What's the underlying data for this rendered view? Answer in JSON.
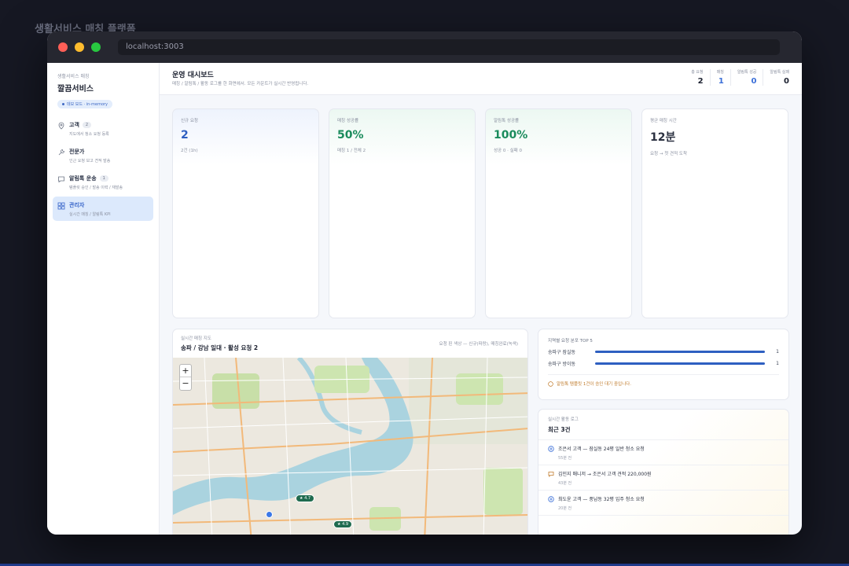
{
  "outer_title": "생활서비스 매칭 플랫폼",
  "browser": {
    "url": "localhost:3003"
  },
  "sidebar": {
    "brand_sub": "생활서비스 매칭",
    "brand": "깔끔서비스",
    "badge": "데모 모드 · in-memory",
    "items": [
      {
        "title": "고객",
        "count": "2",
        "desc": "지도에서 청소 요청 등록",
        "icon": "map-pin-icon"
      },
      {
        "title": "전문가",
        "desc": "인근 요청 보고 견적 발송",
        "icon": "wrench-icon"
      },
      {
        "title": "알림톡 운송",
        "count": "1",
        "desc": "템플릿 승인 / 발송 이력 / 재발송",
        "icon": "message-icon"
      },
      {
        "title": "관리자",
        "desc": "실시간 매칭 / 알림톡 KPI",
        "icon": "dashboard-icon"
      }
    ]
  },
  "header": {
    "title": "운영 대시보드",
    "subtitle": "매칭 / 알림톡 / 활동 로그를 한 화면에서. 모든 카운트가 실시간 반영됩니다.",
    "stats": [
      {
        "label": "총 요청",
        "value": "2",
        "color": "dark"
      },
      {
        "label": "매칭",
        "value": "1",
        "color": "blue"
      },
      {
        "label": "알림톡 성공",
        "value": "0",
        "color": "blue"
      },
      {
        "label": "알림톡 실패",
        "value": "0",
        "color": "dark"
      }
    ]
  },
  "kpis": [
    {
      "label": "신규 요청",
      "value": "2",
      "desc": "2건 (1h)",
      "color": "blue"
    },
    {
      "label": "매칭 성공률",
      "value": "50%",
      "desc": "매칭 1 / 전체 2",
      "color": "green"
    },
    {
      "label": "알림톡 성공률",
      "value": "100%",
      "desc": "성공 0 · 실패 0",
      "color": "green"
    },
    {
      "label": "평균 매칭 시간",
      "value": "12분",
      "desc": "요청 → 첫 견적 도착",
      "color": "dark"
    }
  ],
  "map": {
    "label": "실시간 매칭 지도",
    "title": "송파 / 강남 일대 · 활성 요청 2",
    "legend": "요청 핀 색상 — 신규(파랑), 매칭완료(녹색)",
    "zoom_in": "+",
    "zoom_out": "−",
    "pins": [
      {
        "label": "★ 4.7"
      },
      {
        "label": "★ 4.9"
      }
    ]
  },
  "regions": {
    "title": "지역별 요청 분포 TOP 5",
    "rows": [
      {
        "name": "송파구 잠실동",
        "count": "1",
        "share": 1.0
      },
      {
        "name": "송파구 방이동",
        "count": "1",
        "share": 1.0
      }
    ],
    "note": "알림톡 템플릿 1건이 승인 대기 중입니다."
  },
  "log": {
    "label": "실시간 활동 로그",
    "title": "최근 3건",
    "items": [
      {
        "text": "조은서 고객 — 잠실동 24평 일반 청소 요청",
        "time": "55분 전",
        "icon": "plus-circle-icon"
      },
      {
        "text": "김민지 매니저 → 조은서 고객 견적 220,000원",
        "time": "43분 전",
        "icon": "message-icon"
      },
      {
        "text": "최도윤 고객 — 풍납동 32평 입주 청소 요청",
        "time": "20분 전",
        "icon": "plus-circle-icon"
      }
    ]
  },
  "colors": {
    "accent": "#2e5fc1",
    "success": "#1a8b5c",
    "warning": "#c07a2a"
  }
}
